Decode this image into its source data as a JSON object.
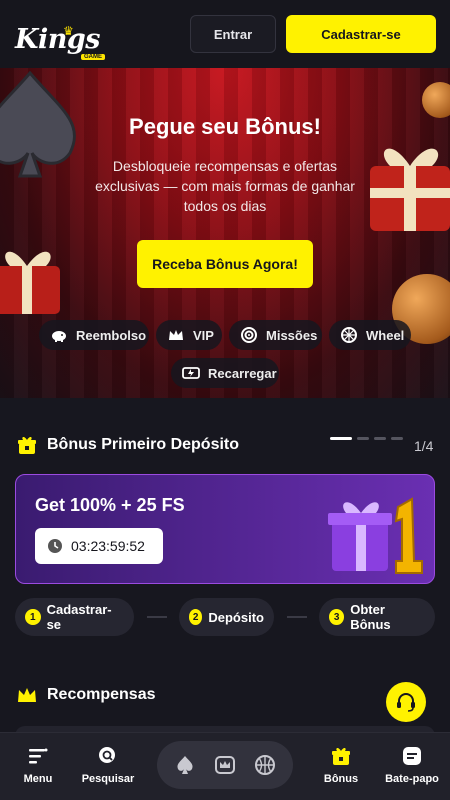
{
  "header": {
    "logo_text": "Kings",
    "logo_sub": "GAME",
    "login_label": "Entrar",
    "signup_label": "Cadastrar-se"
  },
  "hero": {
    "title": "Pegue seu Bônus!",
    "description": "Desbloqueie recompensas e ofertas exclusivas — com mais formas de ganhar todos os dias",
    "cta_label": "Receba Bônus Agora!",
    "chips": [
      {
        "label": "Reembolso",
        "icon": "piggy-bank-icon"
      },
      {
        "label": "VIP",
        "icon": "crown-icon"
      },
      {
        "label": "Missões",
        "icon": "target-icon"
      },
      {
        "label": "Wheel",
        "icon": "wheel-icon"
      },
      {
        "label": "Recarregar",
        "icon": "reload-icon"
      }
    ]
  },
  "first_deposit": {
    "title": "Bônus Primeiro Depósito",
    "pager_text": "1/4",
    "promo_title": "Get 100% + 25 FS",
    "timer": "03:23:59:52",
    "steps": [
      {
        "num": "1",
        "label": "Cadastrar-se"
      },
      {
        "num": "2",
        "label": "Depósito"
      },
      {
        "num": "3",
        "label": "Obter Bônus"
      }
    ]
  },
  "rewards": {
    "title": "Recompensas"
  },
  "bottom_nav": {
    "menu": "Menu",
    "search": "Pesquisar",
    "bonus": "Bônus",
    "chat": "Bate-papo"
  },
  "colors": {
    "accent": "#fff200",
    "background": "#17171f",
    "promo_purple": "#6a2fb2"
  }
}
